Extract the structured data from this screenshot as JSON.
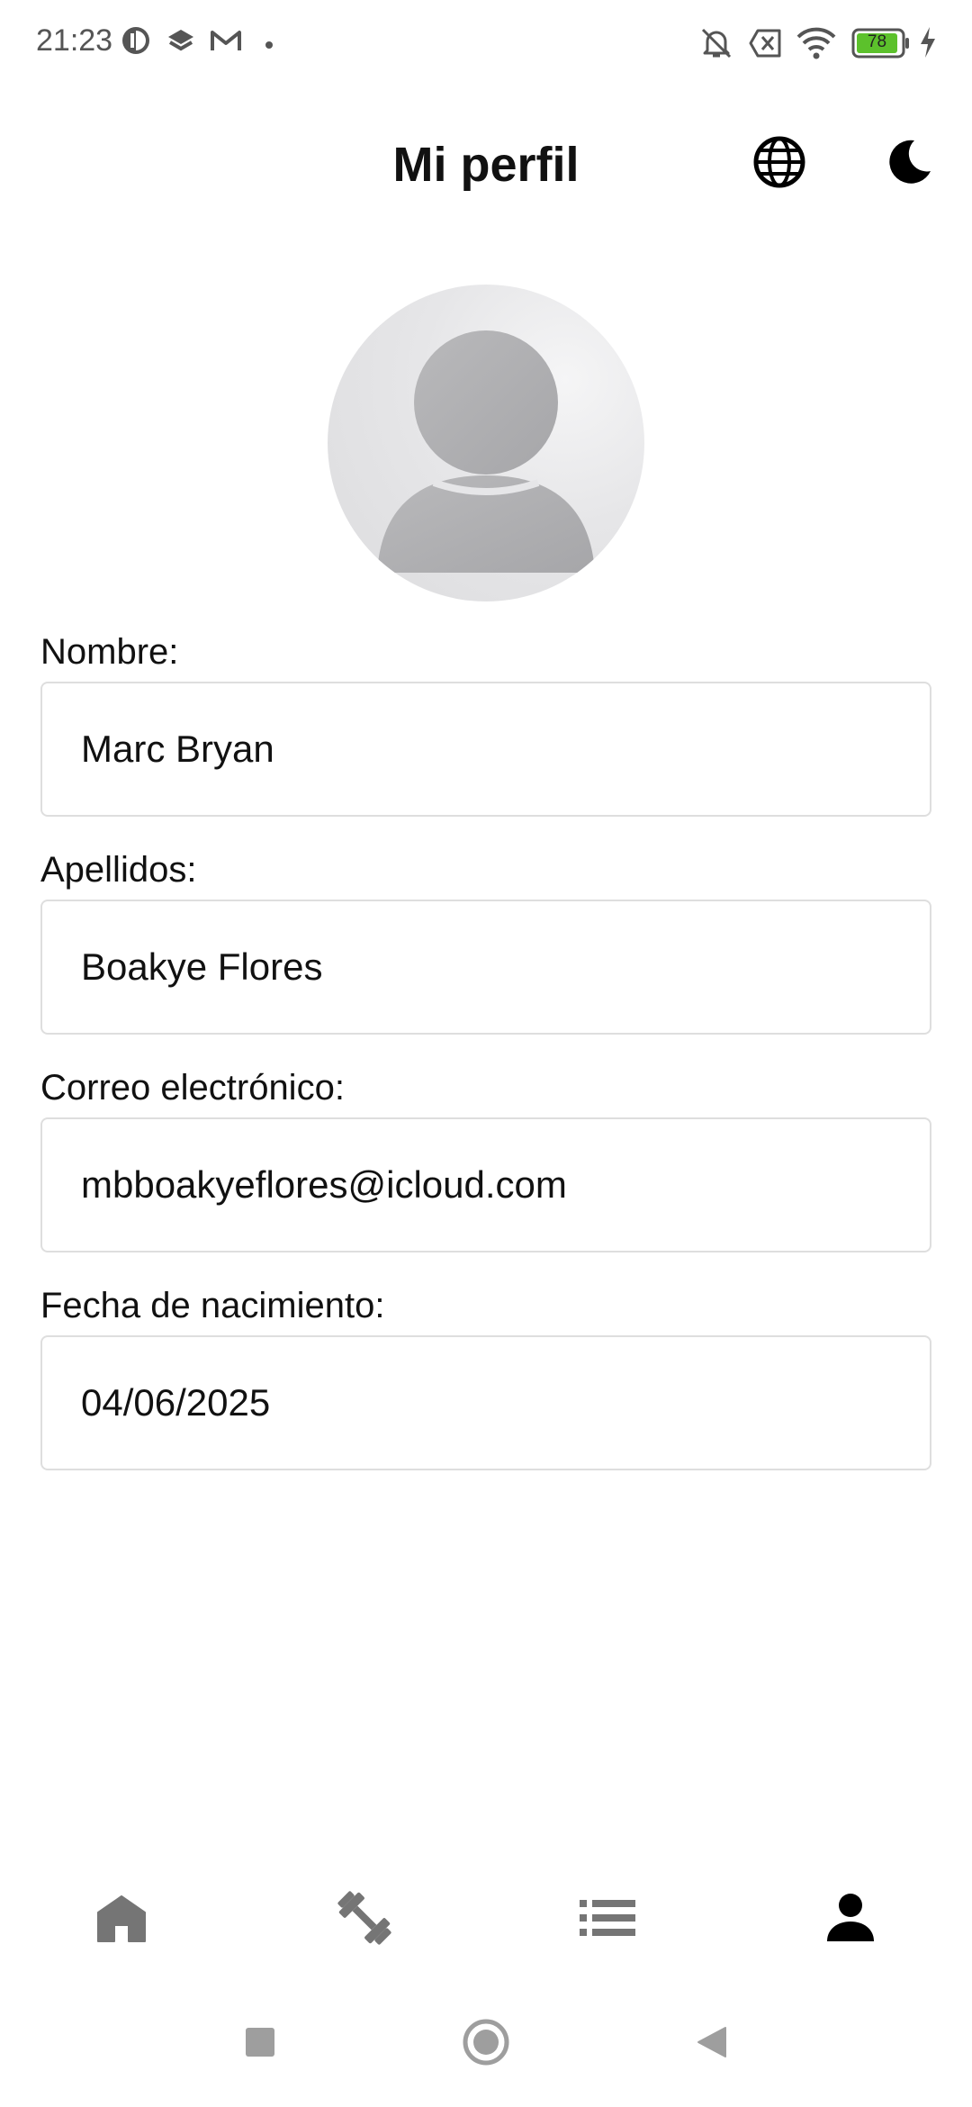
{
  "status_bar": {
    "time": "21:23",
    "battery_level": "78",
    "icons": [
      "notification-app-icon",
      "layers-icon",
      "gmail-icon",
      "dot-icon",
      "bell-off-icon",
      "sim-off-icon",
      "wifi-icon",
      "battery-icon",
      "charging-icon"
    ]
  },
  "header": {
    "title": "Mi perfil",
    "icons": [
      "globe-icon",
      "moon-icon"
    ]
  },
  "profile": {
    "avatar": "avatar-placeholder-icon"
  },
  "form": {
    "fields": [
      {
        "label": "Nombre:",
        "value": "Marc Bryan"
      },
      {
        "label": "Apellidos:",
        "value": "Boakye Flores"
      },
      {
        "label": "Correo electrónico:",
        "value": "mbboakyeflores@icloud.com"
      },
      {
        "label": "Fecha de nacimiento:",
        "value": "04/06/2025"
      }
    ]
  },
  "bottom_nav": {
    "items": [
      "home-icon",
      "dumbbell-icon",
      "list-icon",
      "person-icon"
    ],
    "active": "person-icon"
  },
  "colors": {
    "accent": "#000000",
    "inactive": "#757575",
    "border": "#dedede",
    "battery_fill": "#5cc12c"
  },
  "system_nav": [
    "recents-icon",
    "home-button-icon",
    "back-icon"
  ]
}
